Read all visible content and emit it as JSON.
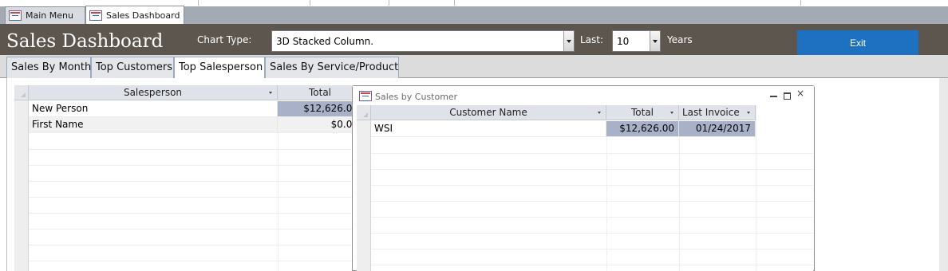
{
  "doc_tabs": [
    {
      "label": "Main Menu",
      "icon": "form-icon"
    },
    {
      "label": "Sales Dashboard",
      "icon": "form-icon"
    }
  ],
  "header": {
    "title": "Sales Dashboard",
    "chart_type_label": "Chart Type:",
    "chart_type_value": "3D Stacked Column.",
    "last_label": "Last:",
    "last_value": "10",
    "years_label": "Years",
    "exit_label": "Exit",
    "colors": {
      "header_bg": "#5c564e",
      "exit_bg": "#1e70c0"
    }
  },
  "tabs": [
    {
      "label": "Sales By Month"
    },
    {
      "label": "Top Customers"
    },
    {
      "label": "Top Salesperson",
      "selected": true
    },
    {
      "label": "Sales By Service/Product"
    }
  ],
  "salesperson_grid": {
    "columns": [
      "Salesperson",
      "Total"
    ],
    "rows": [
      {
        "name": "New Person",
        "total": "$12,626.00"
      },
      {
        "name": "First Name",
        "total": "$0.00"
      }
    ]
  },
  "popup": {
    "title": "Sales by Customer",
    "columns": [
      "Customer Name",
      "Total",
      "Last Invoice"
    ],
    "rows": [
      {
        "customer": "WSI",
        "total": "$12,626.00",
        "last_invoice": "01/24/2017"
      }
    ],
    "controls": [
      "minimize-icon",
      "restore-icon",
      "close-icon"
    ]
  }
}
